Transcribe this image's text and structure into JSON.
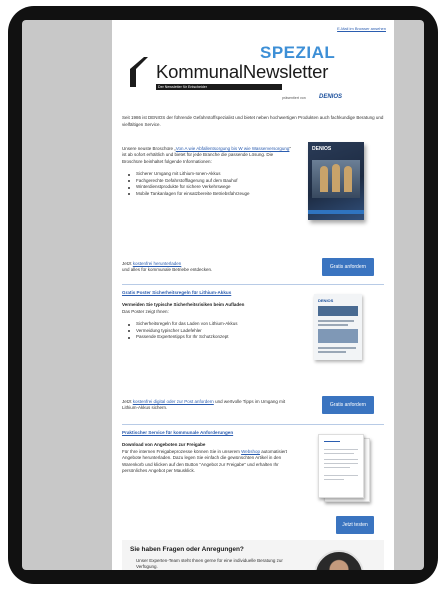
{
  "email": {
    "view_in_browser": "E-Mail im Browser ansehen",
    "logo": {
      "badge": "SPEZIAL",
      "title": "KommunalNewsletter",
      "subtitle": "Der Newsletter für Entscheider",
      "presented_by": "präsentiert von",
      "sponsor": "DENIOS"
    },
    "intro": "Seit 1986 ist DENIOS der führende Gefahrstoffspezialist und bietet neben hochwertigen Produkten auch fachkundige Beratung und vielfältigen Service.",
    "section1": {
      "text_prefix": "Unsere neuste Broschüre „",
      "link": "Von A wie Abfallentsorgung bis W wie Wasserversorgung",
      "text_suffix": "\" ist ab sofort erhältlich und bietet für jede Branche die passende Lösung. Die Broschüre beinhaltet folgende Informationen:",
      "bullets": [
        "Sicherer Umgang mit Lithium-Ionen-Akkus",
        "Fachgerechte Gefahrstofflagerung auf dem Bauhof",
        "Winterdienstprodukte für sichere Verkehrswege",
        "Mobile Tankanlagen für einsatzbereite Betriebsfahrzeuge"
      ],
      "cta_prefix": "Jetzt ",
      "cta_link": "kostenfrei herunterladen",
      "cta_suffix": "und alles für kommunale Betriebe entdecken.",
      "button": "Gratis anfordern",
      "book_title": "DENIOS"
    },
    "section2": {
      "title": "Gratis Poster Sicherheitsregeln für Lithium-Akkus",
      "heading": "Vermeiden Sie typische Sicherheitsrisiken beim Aufladen",
      "lead": "Das Poster zeigt Ihnen:",
      "bullets": [
        "Sicherheitsregeln für das Laden von Lithium-Akkus",
        "Vermeidung typischer Ladefehler",
        "Passende Expertentipps für Ihr Schutzkonzept"
      ],
      "cta_prefix": "Jetzt ",
      "cta_link": "kostenfrei digital oder zur Post anfordern",
      "cta_suffix": " und wertvolle Tipps im Umgang mit Lithium-Akkus sichern.",
      "button": "Gratis anfordern",
      "poster_brand": "DENIOS"
    },
    "section3": {
      "title": "Praktischer Service für kommunale Anforderungen",
      "heading": "Download von Angeboten zur Freigabe",
      "text_prefix": "Für Ihre internen Freigabeprozesse können Sie in unserem ",
      "link": "Webshop",
      "text_suffix": " automatisiert Angebote herunterladen. Dazu legen Sie einfach die gewünschten Artikel in den Warenkorb und klicken auf den Button \"Angebot zur Freigabe\" und erhalten Ihr persönliches Angebot per Mausklick.",
      "button": "Jetzt testen"
    },
    "help": {
      "title": "Sie haben Fragen oder Anregungen?",
      "text": "Unser Experten-Team steht Ihnen gerne für eine individuelle Beratung zur Verfügung."
    }
  }
}
